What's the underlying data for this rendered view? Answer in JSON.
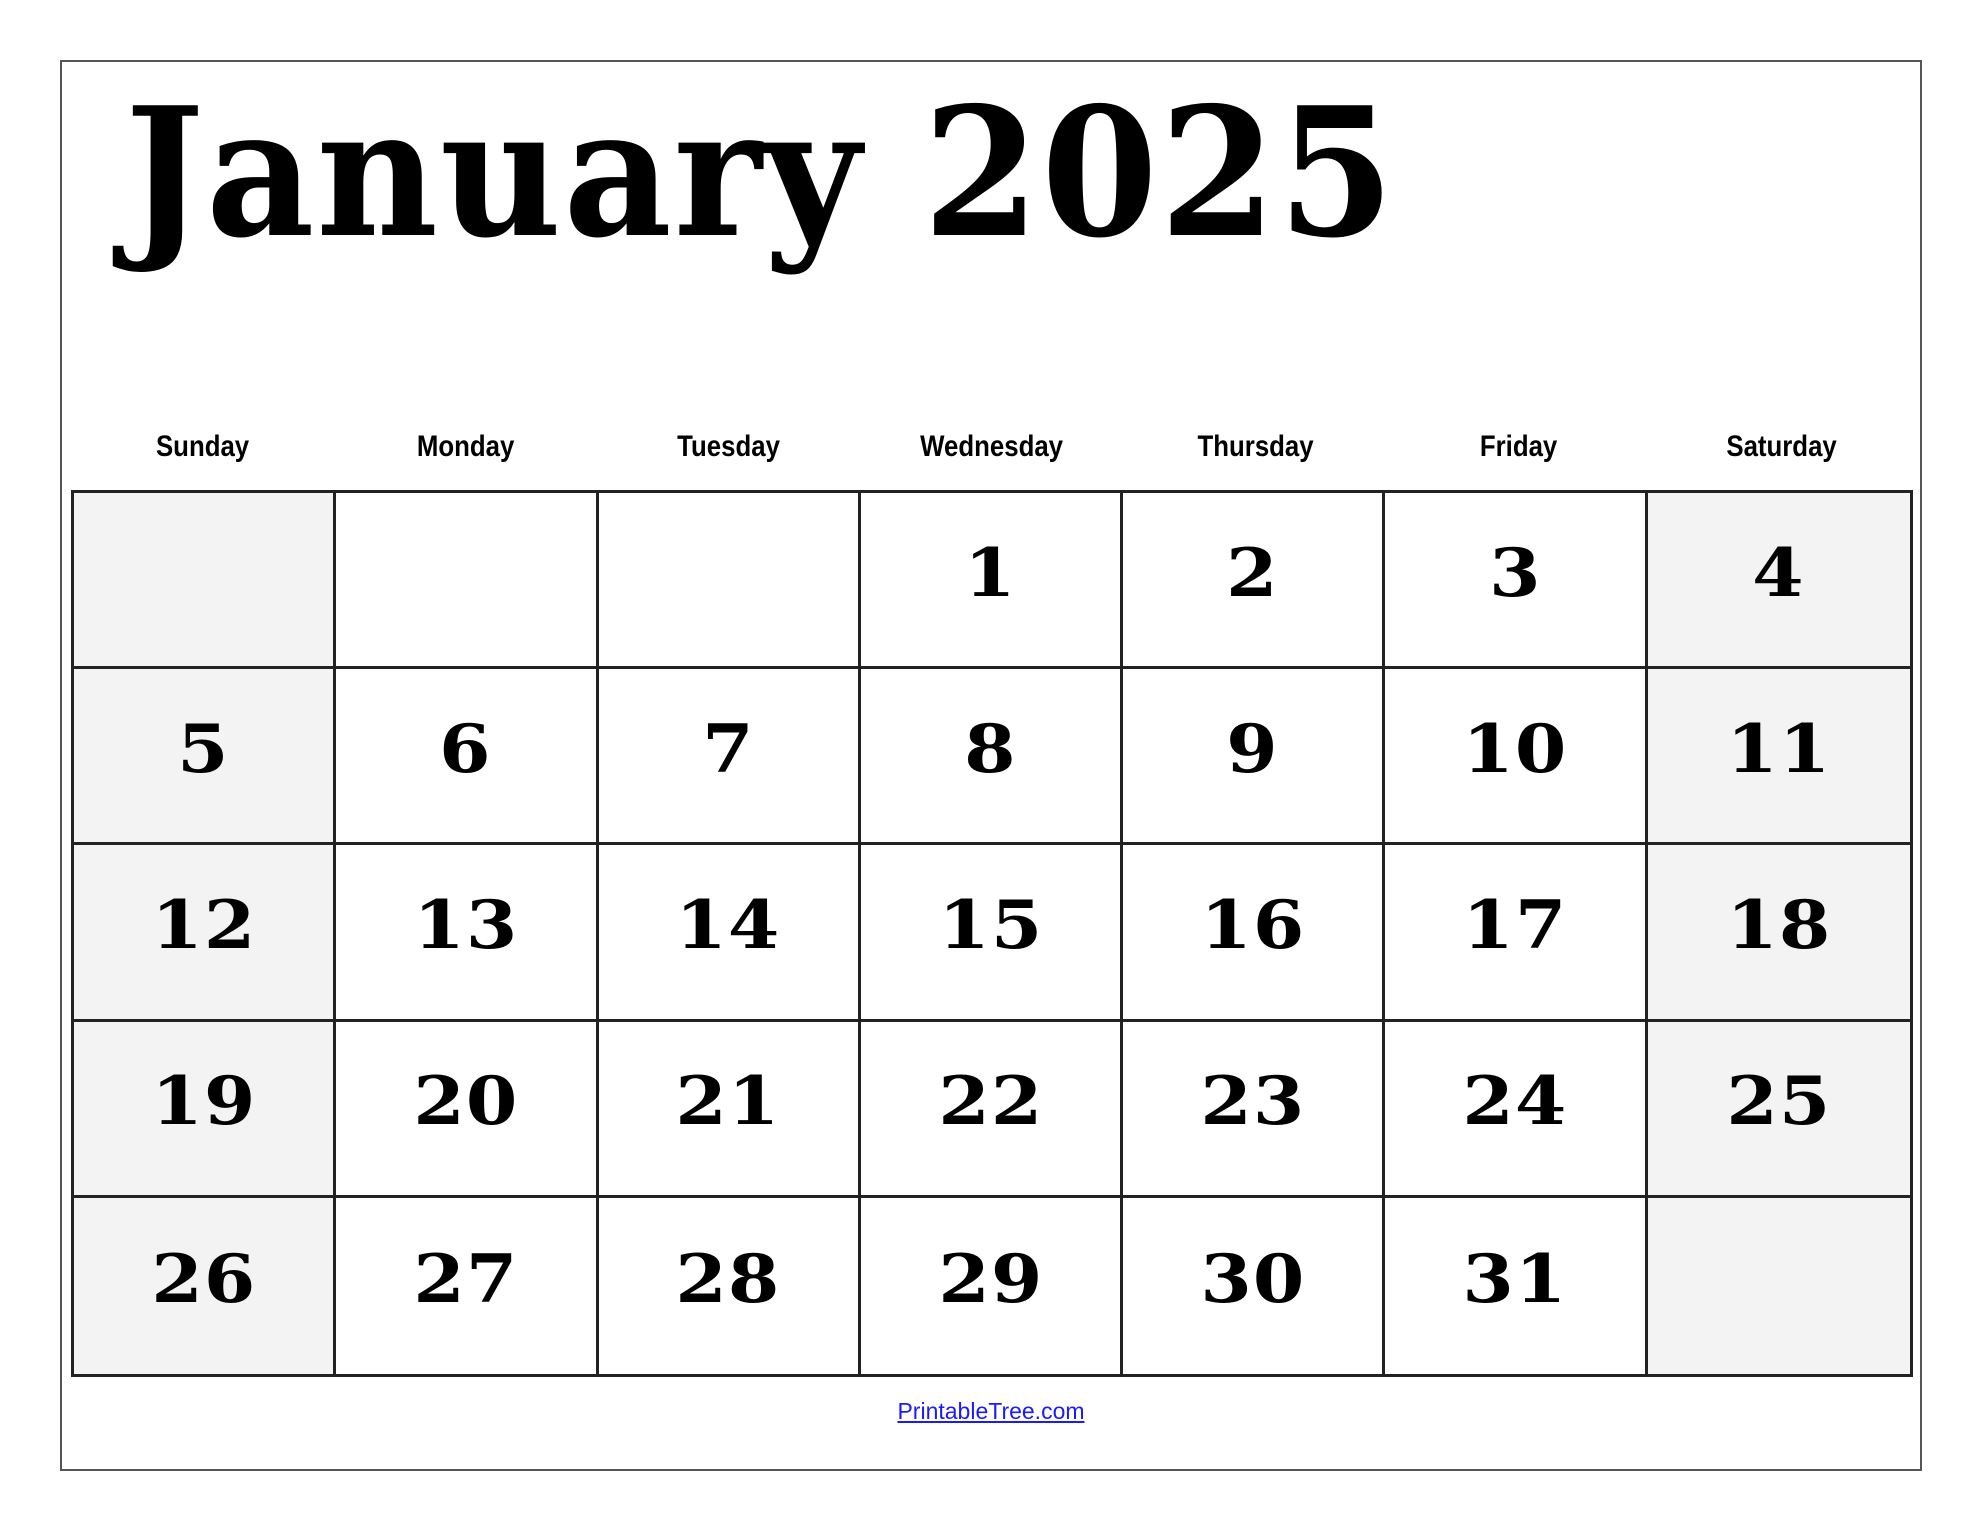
{
  "calendar": {
    "month": "January",
    "year": "2025",
    "title": "January 2025",
    "weekdays": [
      "Sunday",
      "Monday",
      "Tuesday",
      "Wednesday",
      "Thursday",
      "Friday",
      "Saturday"
    ],
    "weeks": [
      [
        "",
        "",
        "",
        "1",
        "2",
        "3",
        "4"
      ],
      [
        "5",
        "6",
        "7",
        "8",
        "9",
        "10",
        "11"
      ],
      [
        "12",
        "13",
        "14",
        "15",
        "16",
        "17",
        "18"
      ],
      [
        "19",
        "20",
        "21",
        "22",
        "23",
        "24",
        "25"
      ],
      [
        "26",
        "27",
        "28",
        "29",
        "30",
        "31",
        ""
      ]
    ],
    "weekend_fill_color": "#f3f3f3"
  },
  "footer": {
    "link_text": "PrintableTree.com",
    "link_color": "#1a1aff"
  }
}
